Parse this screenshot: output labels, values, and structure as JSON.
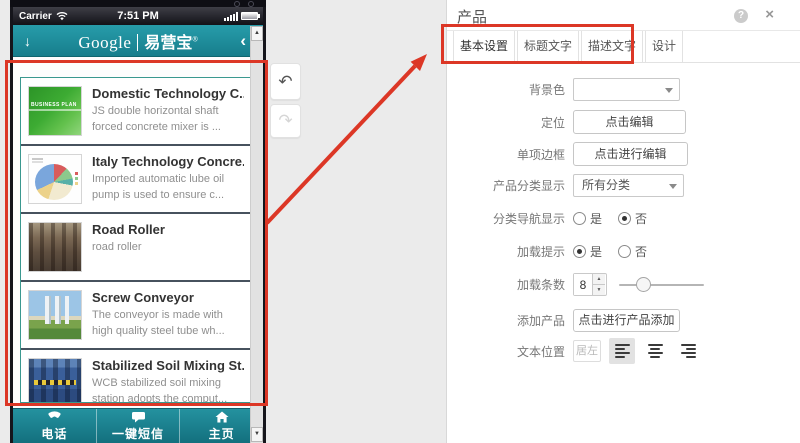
{
  "icons": {
    "header_down": "↓",
    "header_back": "‹",
    "scroll_up": "▲",
    "scroll_down": "▼",
    "undo": "↶",
    "redo": "↷",
    "help": "?",
    "close": "×"
  },
  "phone": {
    "status": {
      "carrier": "Carrier",
      "time": "7:51 PM"
    },
    "header": {
      "logo_en": "Google",
      "logo_cn": "易营宝",
      "reg": "®"
    },
    "products": [
      {
        "title": "Domestic Technology C...",
        "desc": "JS double horizontal shaft forced concrete mixer is ...",
        "thumb_label": "BUSINESS PLAN"
      },
      {
        "title": "Italy Technology Concre...",
        "desc": "Imported automatic lube oil pump is used to ensure c..."
      },
      {
        "title": "Road Roller",
        "desc": "road roller"
      },
      {
        "title": "Screw Conveyor",
        "desc": "The conveyor is made with high quality steel tube wh..."
      },
      {
        "title": "Stabilized Soil Mixing St...",
        "desc": "WCB stabilized soil mixing station adopts the comput..."
      }
    ],
    "nav": [
      {
        "label": "电话"
      },
      {
        "label": "一键短信"
      },
      {
        "label": "主页"
      }
    ]
  },
  "panel": {
    "title": "产品",
    "tabs": [
      {
        "label": "基本设置"
      },
      {
        "label": "标题文字"
      },
      {
        "label": "描述文字"
      },
      {
        "label": "设计"
      }
    ],
    "form": {
      "bg_color": {
        "label": "背景色"
      },
      "position": {
        "label": "定位",
        "button": "点击编辑"
      },
      "item_border": {
        "label": "单项边框",
        "button": "点击进行编辑"
      },
      "category": {
        "label": "产品分类显示",
        "value": "所有分类"
      },
      "cat_nav": {
        "label": "分类导航显示",
        "yes": "是",
        "no": "否",
        "selected": "否"
      },
      "load_tip": {
        "label": "加载提示",
        "yes": "是",
        "no": "否",
        "selected": "是"
      },
      "load_count": {
        "label": "加载条数",
        "value": "8"
      },
      "add_product": {
        "label": "添加产品",
        "button": "点击进行产品添加"
      },
      "text_pos": {
        "label": "文本位置",
        "value": "居左"
      }
    }
  },
  "colors": {
    "teal": "#1e8d9b",
    "annotation": "#dc3726"
  }
}
